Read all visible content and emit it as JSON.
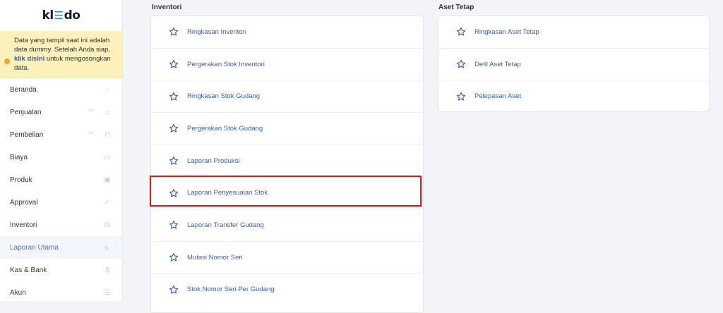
{
  "app": {
    "logo_left": "kl",
    "logo_right": "do"
  },
  "notice": {
    "text_before": "Data yang tampil saat ini adalah data dummy. Setelah Anda siap, ",
    "link": "klik disini",
    "text_after": " untuk mengosongkan data."
  },
  "sidebar": {
    "items": [
      {
        "label": "Beranda",
        "icon": "home-icon",
        "chevron": false,
        "active": false
      },
      {
        "label": "Penjualan",
        "icon": "basket-icon",
        "chevron": true,
        "active": false
      },
      {
        "label": "Pembelian",
        "icon": "bag-icon",
        "chevron": true,
        "active": false
      },
      {
        "label": "Biaya",
        "icon": "card-icon",
        "chevron": false,
        "active": false
      },
      {
        "label": "Produk",
        "icon": "box-icon",
        "chevron": false,
        "active": false
      },
      {
        "label": "Approval",
        "icon": "check-icon",
        "chevron": false,
        "active": false
      },
      {
        "label": "Inventori",
        "icon": "briefcase-icon",
        "chevron": false,
        "active": false
      },
      {
        "label": "Laporan Utama",
        "icon": "chart-icon",
        "chevron": false,
        "active": true
      },
      {
        "label": "Kas & Bank",
        "icon": "dollar-icon",
        "chevron": false,
        "active": false
      },
      {
        "label": "Akun",
        "icon": "list-icon",
        "chevron": false,
        "active": false
      }
    ]
  },
  "inventori": {
    "title": "Inventori",
    "reports": [
      "Ringkasan Inventori",
      "Pergerakan Stok Inventori",
      "Ringkasan Stok Gudang",
      "Pergerakan Stok Gudang",
      "Laporan Produksi",
      "Laporan Penyesuaian Stok",
      "Laporan Transfer Gudang",
      "Mutasi Nomor Seri",
      "Stok Nomor Seri Per Gudang"
    ]
  },
  "aset_tetap": {
    "title": "Aset Tetap",
    "reports": [
      "Ringkasan Aset Tetap",
      "Detil Aset Tetap",
      "Pelepasan Aset"
    ]
  },
  "colors": {
    "accent": "#2f5fc4",
    "highlight": "#e01818",
    "notice_bg": "#fdf1bb"
  }
}
